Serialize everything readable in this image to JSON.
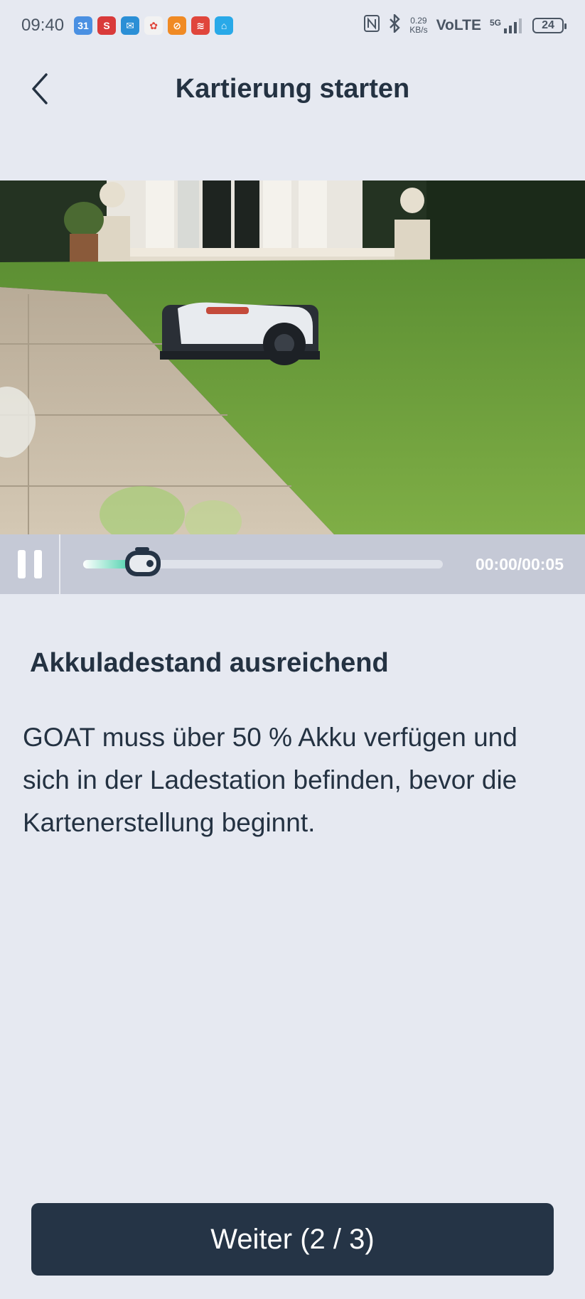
{
  "status_bar": {
    "time": "09:40",
    "notifications": [
      {
        "icon": "calendar-icon",
        "text": "31",
        "color": "#4a90e2"
      },
      {
        "icon": "s-app-icon",
        "text": "S",
        "color": "#d93a3a"
      },
      {
        "icon": "mail-icon",
        "text": "✉",
        "color": "#2b8fd6"
      },
      {
        "icon": "pinwheel-icon",
        "text": "✿",
        "color": "#f2f2f2"
      },
      {
        "icon": "link-app-icon",
        "text": "⊘",
        "color": "#f08a24"
      },
      {
        "icon": "red-app-icon",
        "text": "≋",
        "color": "#e0463c"
      },
      {
        "icon": "home-app-icon",
        "text": "⌂",
        "color": "#29a9e8"
      }
    ],
    "speed_value": "0.29",
    "speed_unit": "KB/s",
    "network": "VoLTE",
    "signal_type": "5G",
    "battery": "24"
  },
  "header": {
    "title": "Kartierung starten"
  },
  "video": {
    "progress": 0.13,
    "time": "00:00/00:05"
  },
  "content": {
    "title": "Akkuladestand ausreichend",
    "description": "GOAT muss über 50 % Akku verfügen und sich in der Ladestation befinden, bevor die Kartenerstellung beginnt."
  },
  "footer": {
    "next_label": "Weiter (2 / 3)"
  },
  "colors": {
    "background": "#e6e9f1",
    "primary_button": "#253446",
    "progress_accent": "#4fd2ae"
  }
}
